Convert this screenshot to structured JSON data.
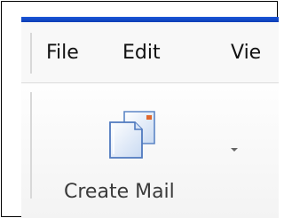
{
  "menubar": {
    "items": [
      {
        "label": "File"
      },
      {
        "label": "Edit"
      },
      {
        "label": "Vie"
      }
    ]
  },
  "toolbar": {
    "create_mail": {
      "label": "Create Mail",
      "icon": "create-mail-icon"
    },
    "dropdown_icon": "chevron-down-icon"
  },
  "colors": {
    "title_bar": "#0a3db6",
    "menubar_bg": "#f8f8f8",
    "text": "#111111"
  }
}
